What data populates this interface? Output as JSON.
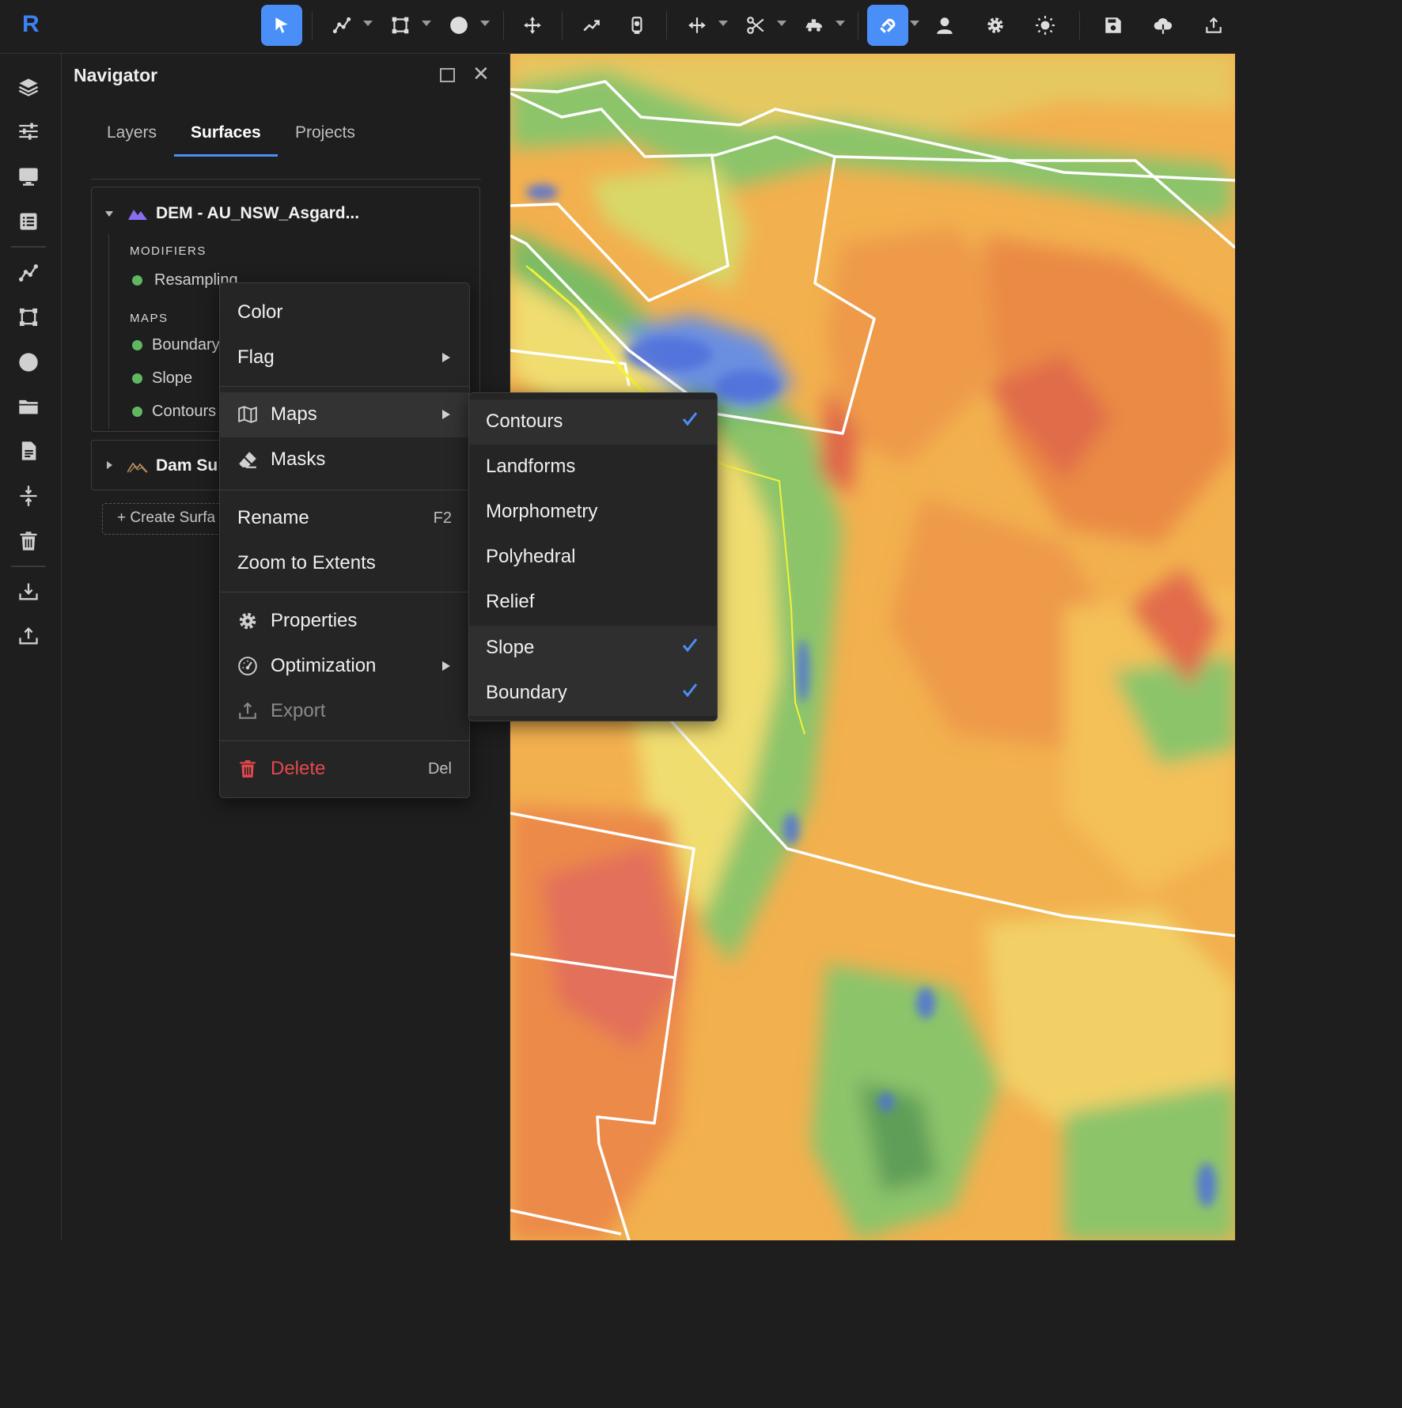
{
  "app": {
    "logo": "R"
  },
  "toolbar": {
    "icons": [
      "pointer-icon",
      "polyline-icon",
      "polygon-icon",
      "circle-icon",
      "move-icon",
      "trend-icon",
      "survey-icon",
      "measure-icon",
      "cut-icon",
      "vehicle-icon",
      "magnet-icon",
      "user-icon",
      "gear-icon",
      "sun-icon",
      "save-icon",
      "cloud-icon",
      "upload-icon"
    ],
    "accent": "#4a8ff7"
  },
  "rail": {
    "icons": [
      "layers-icon",
      "sliders-icon",
      "monitor-icon",
      "list-icon",
      "polyline-icon",
      "polygon-icon",
      "circle-icon",
      "folder-icon",
      "document-icon",
      "compress-icon",
      "trash-icon",
      "download-icon",
      "upload-icon"
    ]
  },
  "navigator": {
    "title": "Navigator",
    "tabs": [
      {
        "label": "Layers"
      },
      {
        "label": "Surfaces"
      },
      {
        "label": "Projects"
      }
    ],
    "active_tab": "Surfaces",
    "surfaces": [
      {
        "title": "DEM - AU_NSW_Asgard...",
        "modifiers_label": "MODIFIERS",
        "modifiers": [
          {
            "label": "Resampling"
          }
        ],
        "maps_label": "MAPS",
        "maps": [
          {
            "label": "Boundary"
          },
          {
            "label": "Slope"
          },
          {
            "label": "Contours"
          }
        ]
      },
      {
        "title": "Dam Su"
      }
    ],
    "create_label": "+ Create Surfa"
  },
  "context_menu": {
    "items": {
      "color": "Color",
      "flag": "Flag",
      "maps": "Maps",
      "masks": "Masks",
      "rename": "Rename",
      "rename_shortcut": "F2",
      "zoom": "Zoom to Extents",
      "properties": "Properties",
      "optimization": "Optimization",
      "export": "Export",
      "delete": "Delete",
      "delete_shortcut": "Del"
    }
  },
  "maps_submenu": {
    "items": [
      {
        "label": "Contours",
        "checked": true
      },
      {
        "label": "Landforms",
        "checked": false
      },
      {
        "label": "Morphometry",
        "checked": false
      },
      {
        "label": "Polyhedral",
        "checked": false
      },
      {
        "label": "Relief",
        "checked": false
      },
      {
        "label": "Slope",
        "checked": true
      },
      {
        "label": "Boundary",
        "checked": true
      }
    ]
  },
  "colors": {
    "delete_red": "#e5484d",
    "status_green": "#5fb85f",
    "check_blue": "#4a8ff7"
  }
}
